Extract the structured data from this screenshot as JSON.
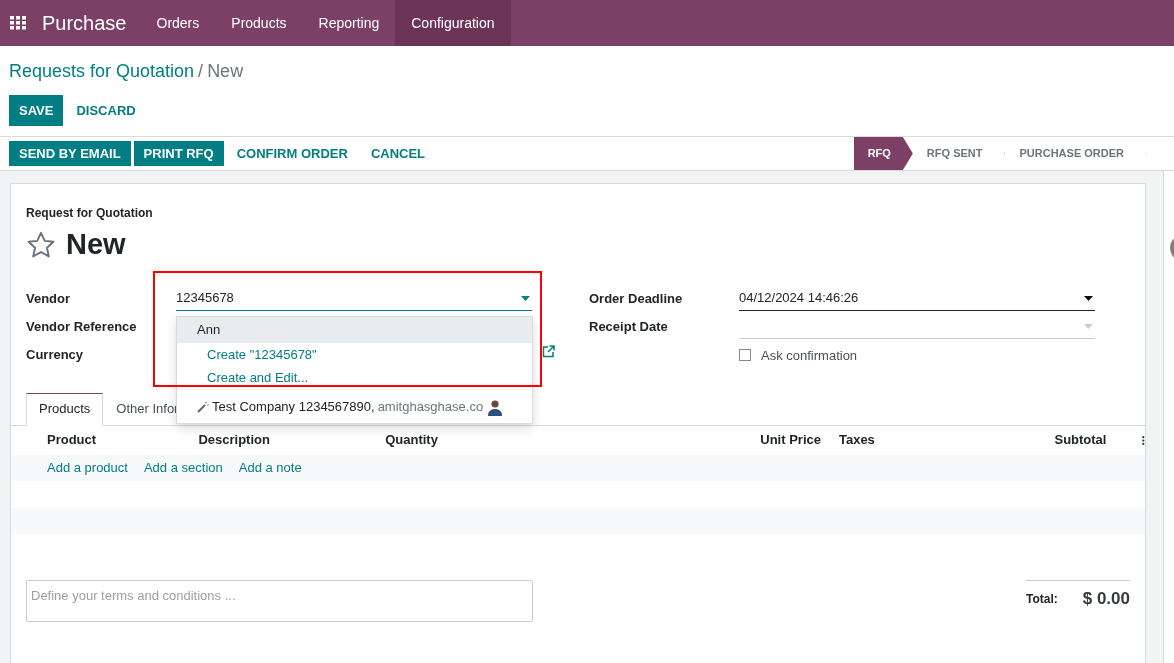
{
  "app": {
    "name": "Purchase"
  },
  "menu": [
    {
      "label": "Orders",
      "selected": false
    },
    {
      "label": "Products",
      "selected": false
    },
    {
      "label": "Reporting",
      "selected": false
    },
    {
      "label": "Configuration",
      "selected": true
    }
  ],
  "breadcrumb": {
    "parent": "Requests for Quotation",
    "separator": "/",
    "current": "New"
  },
  "form_buttons": [
    {
      "label": "SAVE",
      "kind": "primary"
    },
    {
      "label": "DISCARD",
      "kind": "link"
    }
  ],
  "action_buttons": [
    {
      "label": "SEND BY EMAIL",
      "kind": "primary"
    },
    {
      "label": "PRINT RFQ",
      "kind": "primary"
    },
    {
      "label": "CONFIRM ORDER",
      "kind": "link"
    },
    {
      "label": "CANCEL",
      "kind": "link"
    }
  ],
  "stages": [
    {
      "label": "RFQ",
      "selected": true
    },
    {
      "label": "RFQ SENT",
      "selected": false
    },
    {
      "label": "PURCHASE ORDER",
      "selected": false
    }
  ],
  "record": {
    "type_label": "Request for Quotation",
    "name": "New",
    "starred": false
  },
  "left_fields": [
    {
      "label": "Vendor"
    },
    {
      "label": "Vendor Reference"
    },
    {
      "label": "Currency"
    }
  ],
  "vendor_input": {
    "value": "12345678"
  },
  "vendor_dropdown": [
    {
      "kind": "option",
      "label": "Ann",
      "selected": true
    },
    {
      "kind": "action",
      "label": "Create \"12345678\""
    },
    {
      "kind": "action",
      "label": "Create and Edit..."
    },
    {
      "kind": "suggestion",
      "label": "Test Company 1234567890,",
      "detail": "amitghasghase.co"
    }
  ],
  "right_fields": [
    {
      "label": "Order Deadline",
      "value": "04/12/2024 14:46:26",
      "disabled": false
    },
    {
      "label": "Receipt Date",
      "disabled": true
    }
  ],
  "ask_confirmation": {
    "label": "Ask confirmation",
    "checked": false
  },
  "tabs": [
    {
      "label": "Products",
      "selected": true
    },
    {
      "label": "Other Infor",
      "selected": false
    }
  ],
  "table": {
    "columns": [
      "Product",
      "Description",
      "Quantity",
      "Unit Price",
      "Taxes",
      "Subtotal"
    ]
  },
  "row_actions": [
    "Add a product",
    "Add a section",
    "Add a note"
  ],
  "notes": {
    "placeholder": "Define your terms and conditions ..."
  },
  "total": {
    "label": "Total:",
    "value": "$ 0.00"
  }
}
